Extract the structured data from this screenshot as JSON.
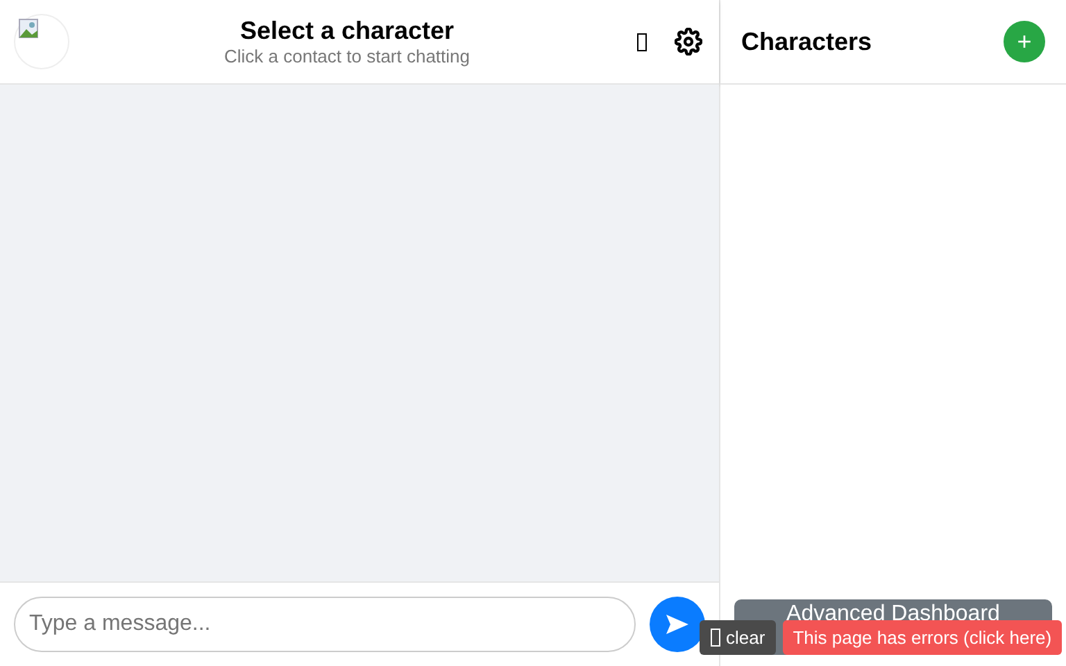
{
  "chat_header": {
    "title": "Select a character",
    "subtitle": "Click a contact to start chatting"
  },
  "composer": {
    "placeholder": "Type a message..."
  },
  "sidebar": {
    "title": "Characters",
    "add_label": "+",
    "dashboard_button": "Advanced Dashboard"
  },
  "error_overlay": {
    "clear_label": "clear",
    "error_message": "This page has errors (click here)"
  }
}
